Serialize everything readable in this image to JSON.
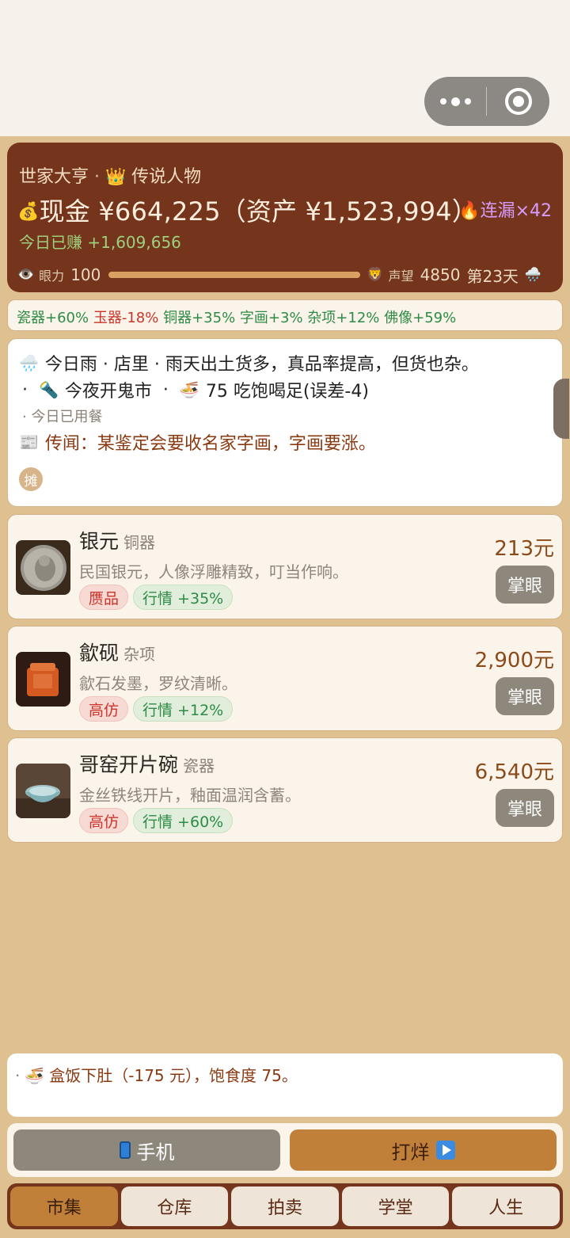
{
  "status": {
    "rank_left": "世家大亨",
    "rank_sep": " · ",
    "rank_icon": "crown-icon",
    "rank_right": "传说人物",
    "cash_label": "现金",
    "cash_value": "¥664,225",
    "assets": "（资产 ¥1,523,994）",
    "streak": "连漏×42",
    "earned": "今日已赚 +1,609,656",
    "eye_label": "眼力",
    "eye_value": "100",
    "eye_progress": 1.0,
    "fame_label": "声望",
    "fame_value": "4850",
    "day": "第23天"
  },
  "bonuses": [
    {
      "text": "瓷器+60%",
      "tone": "up"
    },
    {
      "text": "玉器-18%",
      "tone": "down"
    },
    {
      "text": "铜器+35%",
      "tone": "up"
    },
    {
      "text": "字画+3%",
      "tone": "up"
    },
    {
      "text": "杂项+12%",
      "tone": "up"
    },
    {
      "text": "佛像+59%",
      "tone": "up"
    }
  ],
  "news": {
    "weather": "今日雨 · 店里 · 雨天出土货多，真品率提高，但货也杂。",
    "ghost_market_prefix": "·",
    "ghost_market": "今夜开鬼市",
    "meal_prefix": "·",
    "meal": "75 吃饱喝足(误差-4)",
    "meal_status": "· 今日已用餐",
    "rumor": "传闻：某鉴定会要收名家字画，字画要涨。",
    "stall_badge": "摊"
  },
  "items": [
    {
      "name": "银元",
      "category": "铜器",
      "desc": "民国银元，人像浮雕精致，叮当作响。",
      "grade": "赝品",
      "market": "行情 +35%",
      "price": "213元",
      "action": "掌眼"
    },
    {
      "name": "歙砚",
      "category": "杂项",
      "desc": "歙石发墨，罗纹清晰。",
      "grade": "高仿",
      "market": "行情 +12%",
      "price": "2,900元",
      "action": "掌眼"
    },
    {
      "name": "哥窑开片碗",
      "category": "瓷器",
      "desc": "金丝铁线开片，釉面温润含蓄。",
      "grade": "高仿",
      "market": "行情 +60%",
      "price": "6,540元",
      "action": "掌眼"
    }
  ],
  "log": {
    "dot": "·",
    "text": "盒饭下肚（-175 元），饱食度 75。"
  },
  "actions": {
    "phone": "手机",
    "close": "打烊"
  },
  "tabs": [
    "市集",
    "仓库",
    "拍卖",
    "学堂",
    "人生"
  ],
  "active_tab": "市集"
}
